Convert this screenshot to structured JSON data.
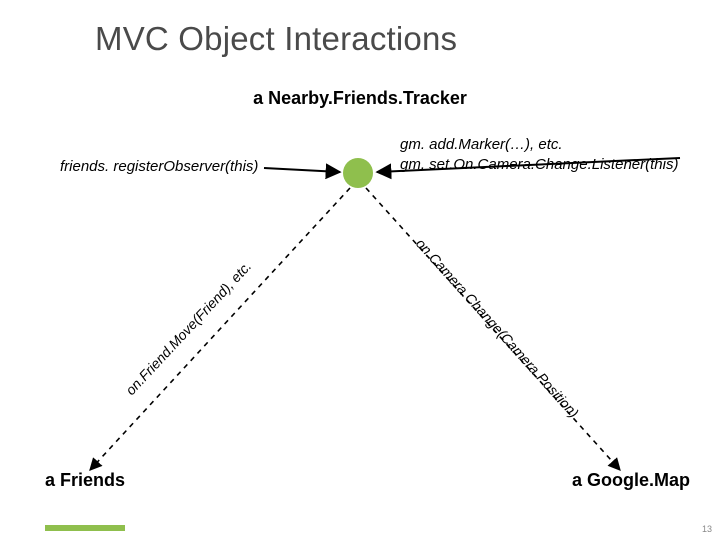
{
  "title": "MVC Object Interactions",
  "subtitle": "a Nearby.Friends.Tracker",
  "leftCall": "friends. registerObserver(this)",
  "rightCall1": "gm. add.Marker(…), etc.",
  "rightCall2": "gm. set.On.Camera.Change.Listener(this)",
  "leftEdge": "on.Friend.Move(Friend), etc.",
  "rightEdge": "on.Camera.Change(Camera.Position)",
  "friends": "a Friends",
  "gmap": "a Google.Map",
  "pageNum": "13",
  "colors": {
    "accent": "#8fbf4d"
  }
}
